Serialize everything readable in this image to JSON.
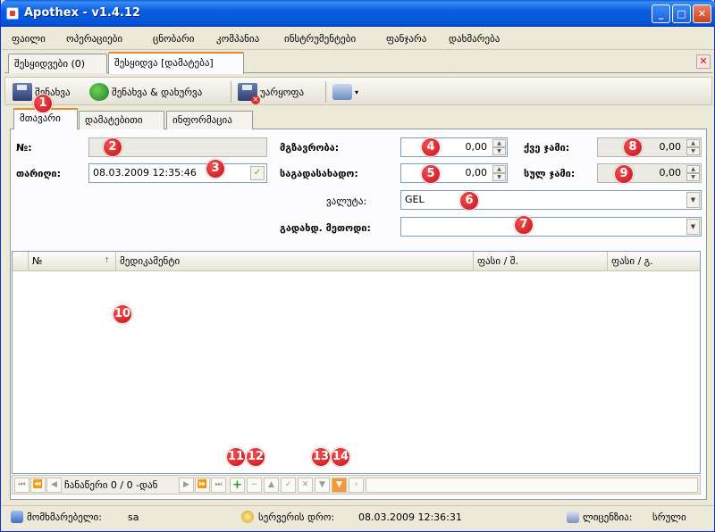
{
  "window": {
    "title": "Apothex - v1.4.12",
    "min": "_",
    "max": "□",
    "close": "✕"
  },
  "menu": [
    "ფაილი",
    "ოპერაციები",
    "ცნობარი",
    "კომპანია",
    "ინსტრუმენტები",
    "ფანჯარა",
    "დახმარება"
  ],
  "doc_tabs": [
    "შესყიდვები (0)",
    "შესყიდვა [დამატება]"
  ],
  "close_doc": "✕",
  "toolbar": {
    "save": "შენახვა",
    "save_close": "შენახვა & დახურვა",
    "cancel": "უარყოფა",
    "dropdown": "▾"
  },
  "inner_tabs": [
    "მთავარი",
    "დამატებითი",
    "ინფორმაცია"
  ],
  "form": {
    "number_label": "№:",
    "number_value": "",
    "date_label": "თარიღი:",
    "date_value": "08.03.2009 12:35:46",
    "date_check": "✓",
    "shipping_label": "მგზავრობა:",
    "shipping_value": "0,00",
    "customs_label": "საგადასახადო:",
    "customs_value": "0,00",
    "subtotal_label": "ქვე ჯამი:",
    "subtotal_value": "0,00",
    "total_label": "სულ ჯამი:",
    "total_value": "0,00",
    "currency_label": "ვალუტა:",
    "currency_value": "GEL",
    "payment_label": "გადახდ. მეთოდი:",
    "payment_value": "",
    "spin_up": "▲",
    "spin_down": "▼",
    "dd_arrow": "▼"
  },
  "grid": {
    "columns": [
      "№",
      "მედიკამენტი",
      "ფასი / შ.",
      "ფასი / გ."
    ],
    "sort_indicator": "↑",
    "rows": []
  },
  "navigator": {
    "first": "⏮",
    "prev_page": "⏪",
    "prev": "◀",
    "text": "ჩანაწერი 0 / 0 -დან",
    "next": "▶",
    "next_page": "⏩",
    "last": "⏭",
    "add": "+",
    "remove": "−",
    "up": "▲",
    "apply": "✓",
    "discard": "✕",
    "filter": "▼",
    "filter2": "▼",
    "scroll_left": "‹"
  },
  "status": {
    "user_label": "მომხმარებელი:",
    "user_value": "sa",
    "server_time_label": "სერვერის დრო:",
    "server_time_value": "08.03.2009 12:36:31",
    "license_label": "ლიცენზია:",
    "license_value": "სრული"
  },
  "markers": [
    "1",
    "2",
    "3",
    "4",
    "5",
    "6",
    "7",
    "8",
    "9",
    "10",
    "11",
    "12",
    "13",
    "14"
  ]
}
